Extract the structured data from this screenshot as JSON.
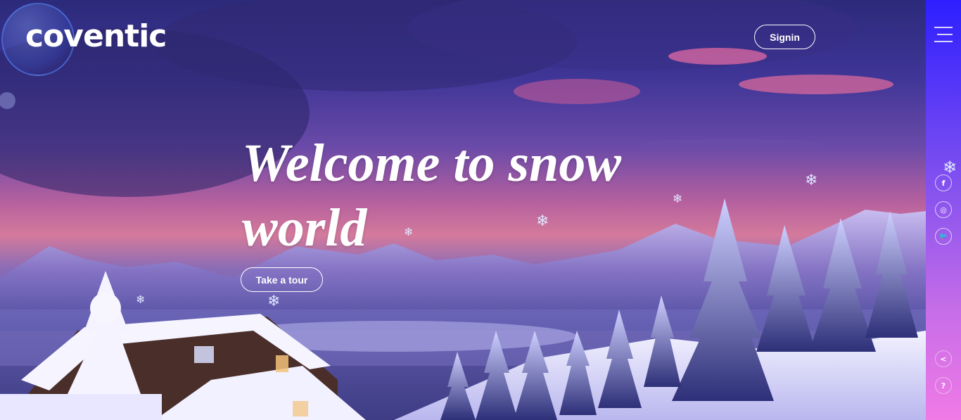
{
  "header": {
    "logo_text": "coventic",
    "signin_label": "Signin"
  },
  "hero": {
    "headline": "Welcome to snow world",
    "cta_label": "Take a tour"
  },
  "rail": {
    "menu_icon": "hamburger-menu-icon",
    "social": [
      {
        "name": "facebook-icon",
        "glyph": "f"
      },
      {
        "name": "instagram-icon",
        "glyph": "◎"
      },
      {
        "name": "twitter-icon",
        "glyph": "🐦"
      }
    ],
    "bottom": [
      {
        "name": "share-icon",
        "glyph": "<"
      },
      {
        "name": "help-icon",
        "glyph": "?"
      }
    ]
  },
  "colors": {
    "rail_top": "#2d1fff",
    "rail_bottom": "#f07ae6",
    "text": "#ffffff"
  }
}
